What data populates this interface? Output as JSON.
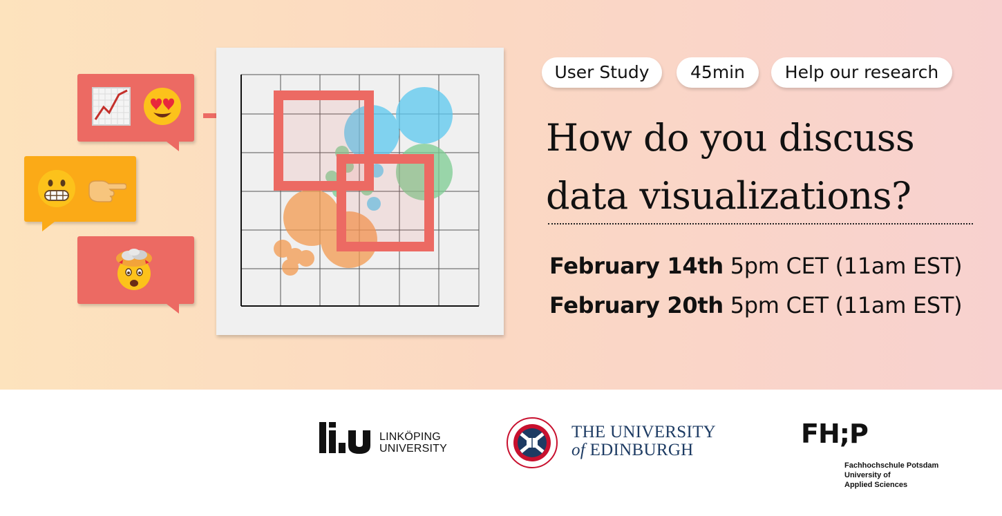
{
  "pills": [
    "User Study",
    "45min",
    "Help our research"
  ],
  "headline": [
    "How do you discuss",
    "data visualizations?"
  ],
  "sessions": [
    {
      "date": "February 14th",
      "time": "5pm CET (11am EST)"
    },
    {
      "date": "February 20th",
      "time": "5pm CET (11am EST)"
    }
  ],
  "bubbles": [
    {
      "color": "#ec6a63",
      "icons": [
        "chart-increasing-icon",
        "heart-eyes-icon"
      ]
    },
    {
      "color": "#fbaa17",
      "icons": [
        "grimacing-face-icon",
        "pointing-right-icon"
      ]
    },
    {
      "color": "#ec6a63",
      "icons": [
        "exploding-head-icon"
      ]
    }
  ],
  "colors": {
    "accent": "#ec6a63",
    "orange": "#fbaa17",
    "blue": "#5bc8ef",
    "green": "#7ccc92",
    "bubble_orange": "#f39a4f"
  },
  "logos": {
    "liu": {
      "line1": "LINKÖPING",
      "line2": "UNIVERSITY"
    },
    "edinburgh": {
      "line1": "THE UNIVERSITY",
      "line2_of": "of",
      "line2": "EDINBURGH"
    },
    "fhp": {
      "mark": "FH;P",
      "line1": "Fachhochschule Potsdam",
      "line2": "University of",
      "line3": "Applied Sciences"
    }
  }
}
